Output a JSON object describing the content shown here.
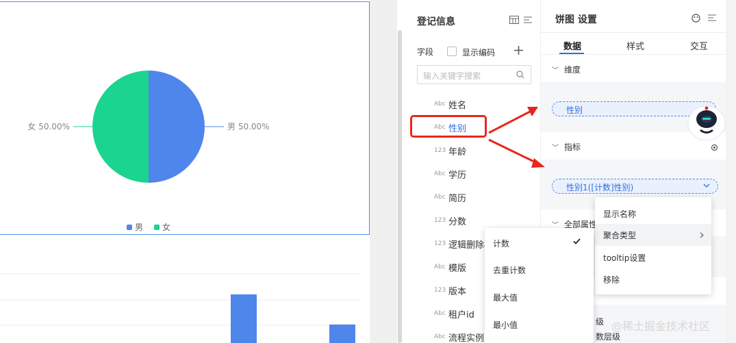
{
  "colors": {
    "male": "#4f86ec",
    "female": "#1ad48f",
    "accent": "#4a8bf1",
    "arrow": "#e8261b"
  },
  "chart_data": [
    {
      "type": "pie",
      "categories": [
        "男",
        "女"
      ],
      "values": [
        50.0,
        50.0
      ],
      "data_labels": [
        "男 50.00%",
        "女 50.00%"
      ],
      "legend": [
        "男",
        "女"
      ],
      "legend_position": "bottom"
    },
    {
      "type": "bar",
      "categories": [],
      "values": [],
      "note_visible": ""
    }
  ],
  "data_panel": {
    "title": "登记信息",
    "field_label": "字段",
    "show_code_label": "显示编码",
    "search_placeholder": "输入关键字搜索",
    "fields": [
      {
        "type": "Abc",
        "name": "姓名"
      },
      {
        "type": "Abc",
        "name": "性别"
      },
      {
        "type": "123",
        "name": "年龄"
      },
      {
        "type": "Abc",
        "name": "学历"
      },
      {
        "type": "Abc",
        "name": "简历"
      },
      {
        "type": "123",
        "name": "分数"
      },
      {
        "type": "123",
        "name": "逻辑删除标"
      },
      {
        "type": "Abc",
        "name": "模版"
      },
      {
        "type": "123",
        "name": "版本"
      },
      {
        "type": "Abc",
        "name": "租户id"
      },
      {
        "type": "Abc",
        "name": "流程实例"
      }
    ]
  },
  "settings_panel": {
    "title": "饼图 设置",
    "tabs": [
      "数据",
      "样式",
      "交互"
    ],
    "dimension_label": "维度",
    "dimension_pill": "性别",
    "measure_label": "指标",
    "measure_pill": "性别1([计数]性别)",
    "all_props_label": "全部属性",
    "bottom_text_1": "级",
    "bottom_text_2": "数层级"
  },
  "context_menu": {
    "items": [
      "显示名称",
      "聚合类型",
      "tooltip设置",
      "移除"
    ]
  },
  "aggregation_menu": {
    "items": [
      "计数",
      "去重计数",
      "最大值",
      "最小值"
    ],
    "checked_index": 0
  },
  "watermark": "@稀土掘金技术社区"
}
